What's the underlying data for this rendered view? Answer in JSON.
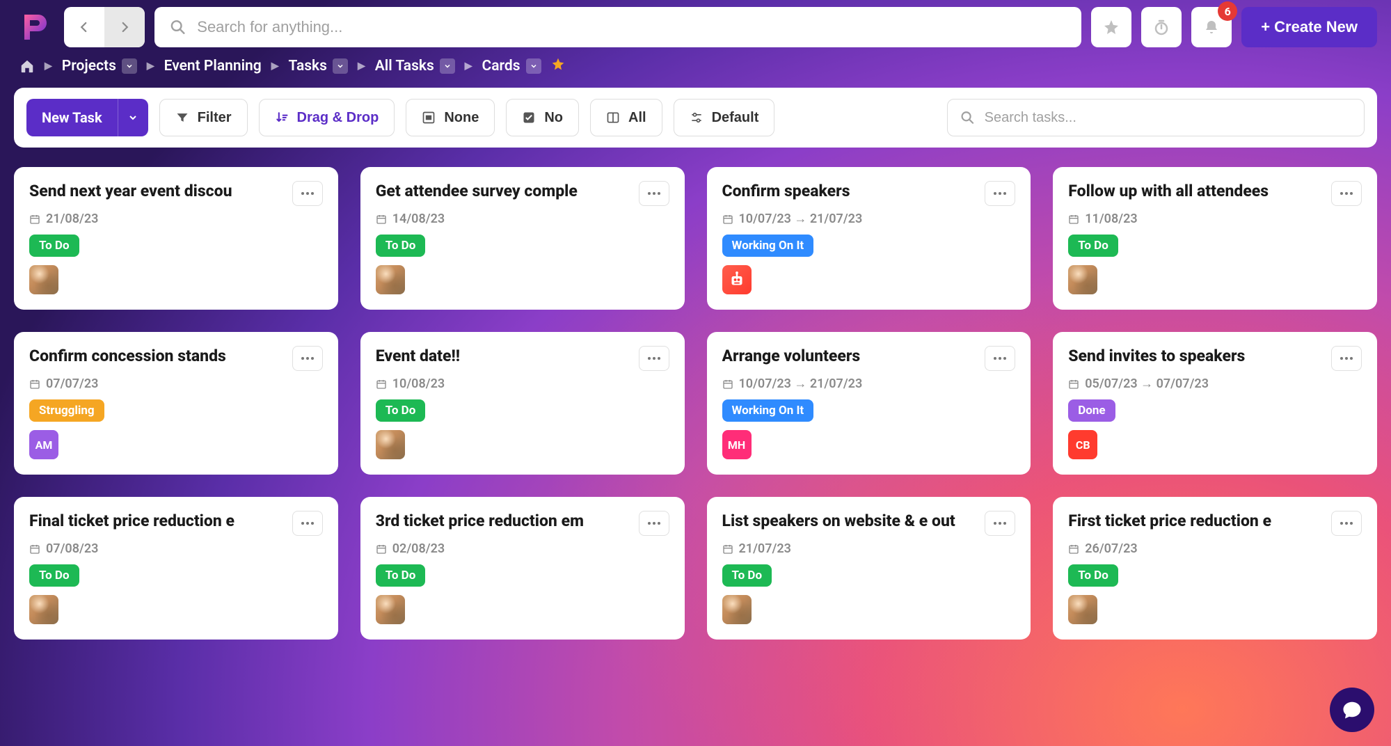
{
  "colors": {
    "primary": "#5b2dc7",
    "badge": "#e53935",
    "status_todo": "#1db954",
    "status_working": "#2f8bff",
    "status_struggling": "#f5a623",
    "status_done": "#9b5de5",
    "avatar_am": "#9b5de5",
    "avatar_mh": "#ff2d78",
    "avatar_cb": "#ff3b2e"
  },
  "header": {
    "search_placeholder": "Search for anything...",
    "notification_count": "6",
    "create_label": "+ Create New"
  },
  "breadcrumbs": {
    "items": [
      "Projects",
      "Event Planning",
      "Tasks",
      "All Tasks",
      "Cards"
    ]
  },
  "toolbar": {
    "new_task": "New Task",
    "filter": "Filter",
    "sort": "Drag & Drop",
    "group": "None",
    "completed": "No",
    "columns": "All",
    "settings": "Default",
    "search_placeholder": "Search tasks..."
  },
  "statuses": {
    "todo": "To Do",
    "working": "Working On It",
    "struggling": "Struggling",
    "done": "Done"
  },
  "cards": [
    {
      "title": "Send next year event discou",
      "date": "21/08/23",
      "status": "todo",
      "avatar_type": "photo",
      "avatar_text": "",
      "one_line": true
    },
    {
      "title": "Get attendee survey comple",
      "date": "14/08/23",
      "status": "todo",
      "avatar_type": "photo",
      "avatar_text": "",
      "one_line": true
    },
    {
      "title": "Confirm speakers",
      "date": "10/07/23 → 21/07/23",
      "status": "working",
      "avatar_type": "robot",
      "avatar_text": "",
      "one_line": true
    },
    {
      "title": "Follow up with all attendees",
      "date": "11/08/23",
      "status": "todo",
      "avatar_type": "photo",
      "avatar_text": "",
      "one_line": true
    },
    {
      "title": "Confirm concession stands",
      "date": "07/07/23",
      "status": "struggling",
      "avatar_type": "initials",
      "avatar_text": "AM",
      "avatar_color": "avatar_am",
      "one_line": true
    },
    {
      "title": "Event date!!",
      "date": "10/08/23",
      "status": "todo",
      "avatar_type": "photo",
      "avatar_text": "",
      "one_line": true
    },
    {
      "title": "Arrange volunteers",
      "date": "10/07/23 → 21/07/23",
      "status": "working",
      "avatar_type": "initials",
      "avatar_text": "MH",
      "avatar_color": "avatar_mh",
      "one_line": true
    },
    {
      "title": "Send invites to speakers",
      "date": "05/07/23 → 07/07/23",
      "status": "done",
      "avatar_type": "initials",
      "avatar_text": "CB",
      "avatar_color": "avatar_cb",
      "one_line": true
    },
    {
      "title": "Final ticket price reduction e",
      "date": "07/08/23",
      "status": "todo",
      "avatar_type": "photo",
      "avatar_text": "",
      "one_line": true
    },
    {
      "title": "3rd ticket price reduction em",
      "date": "02/08/23",
      "status": "todo",
      "avatar_type": "photo",
      "avatar_text": "",
      "one_line": true
    },
    {
      "title": "List speakers on website & e out",
      "date": "21/07/23",
      "status": "todo",
      "avatar_type": "photo",
      "avatar_text": "",
      "one_line": false
    },
    {
      "title": "First ticket price reduction e",
      "date": "26/07/23",
      "status": "todo",
      "avatar_type": "photo",
      "avatar_text": "",
      "one_line": true
    }
  ]
}
